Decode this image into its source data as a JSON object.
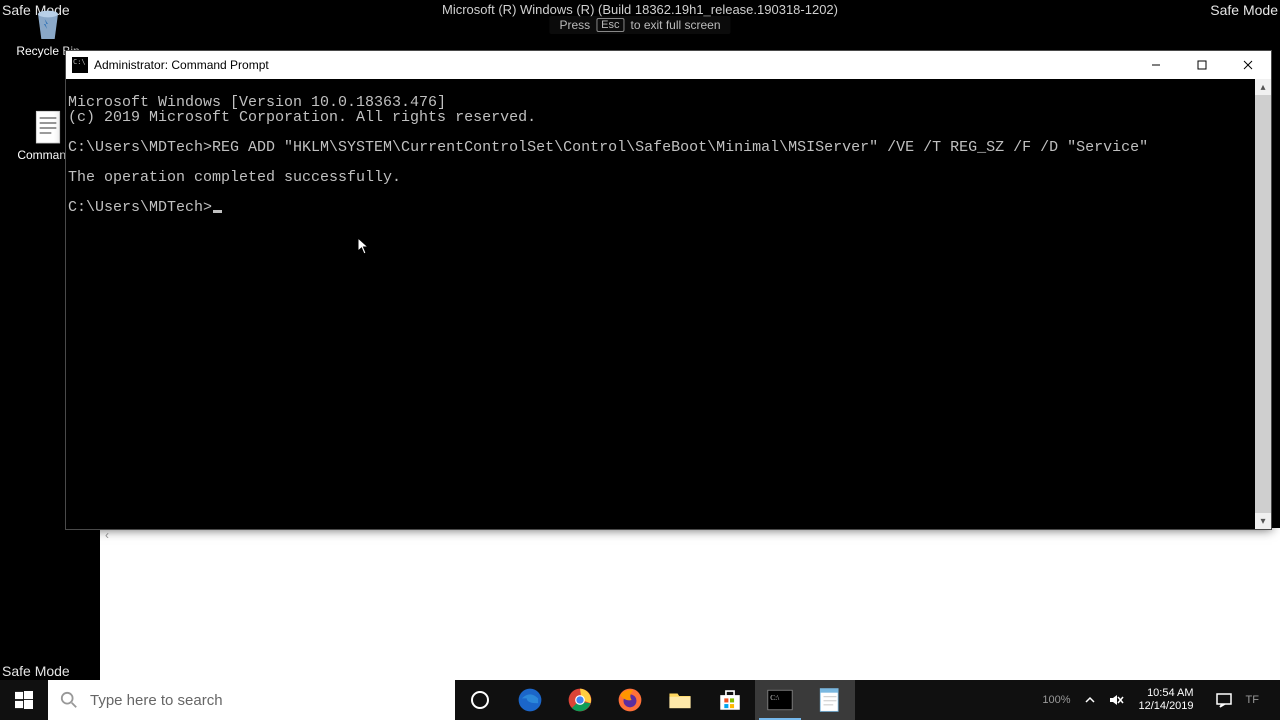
{
  "safe_mode": {
    "label": "Safe Mode",
    "build": "Microsoft (R) Windows (R) (Build 18362.19h1_release.190318-1202)"
  },
  "fullscreen_hint": {
    "pre": "Press",
    "key": "Esc",
    "post": "to exit full screen"
  },
  "desktop_icons": {
    "recycle_bin": "Recycle Bin",
    "commands_doc": "Commands"
  },
  "cmd": {
    "title": "Administrator: Command Prompt",
    "line1": "Microsoft Windows [Version 10.0.18363.476]",
    "line2": "(c) 2019 Microsoft Corporation. All rights reserved.",
    "prompt1": "C:\\Users\\MDTech>",
    "command": "REG ADD \"HKLM\\SYSTEM\\CurrentControlSet\\Control\\SafeBoot\\Minimal\\MSIServer\" /VE /T REG_SZ /F /D \"Service\"",
    "result": "The operation completed successfully.",
    "prompt2": "C:\\Users\\MDTech>"
  },
  "search": {
    "placeholder": "Type here to search"
  },
  "tray": {
    "time": "10:54 AM",
    "date": "12/14/2019",
    "zoom": "100%",
    "right_text": "TF"
  }
}
